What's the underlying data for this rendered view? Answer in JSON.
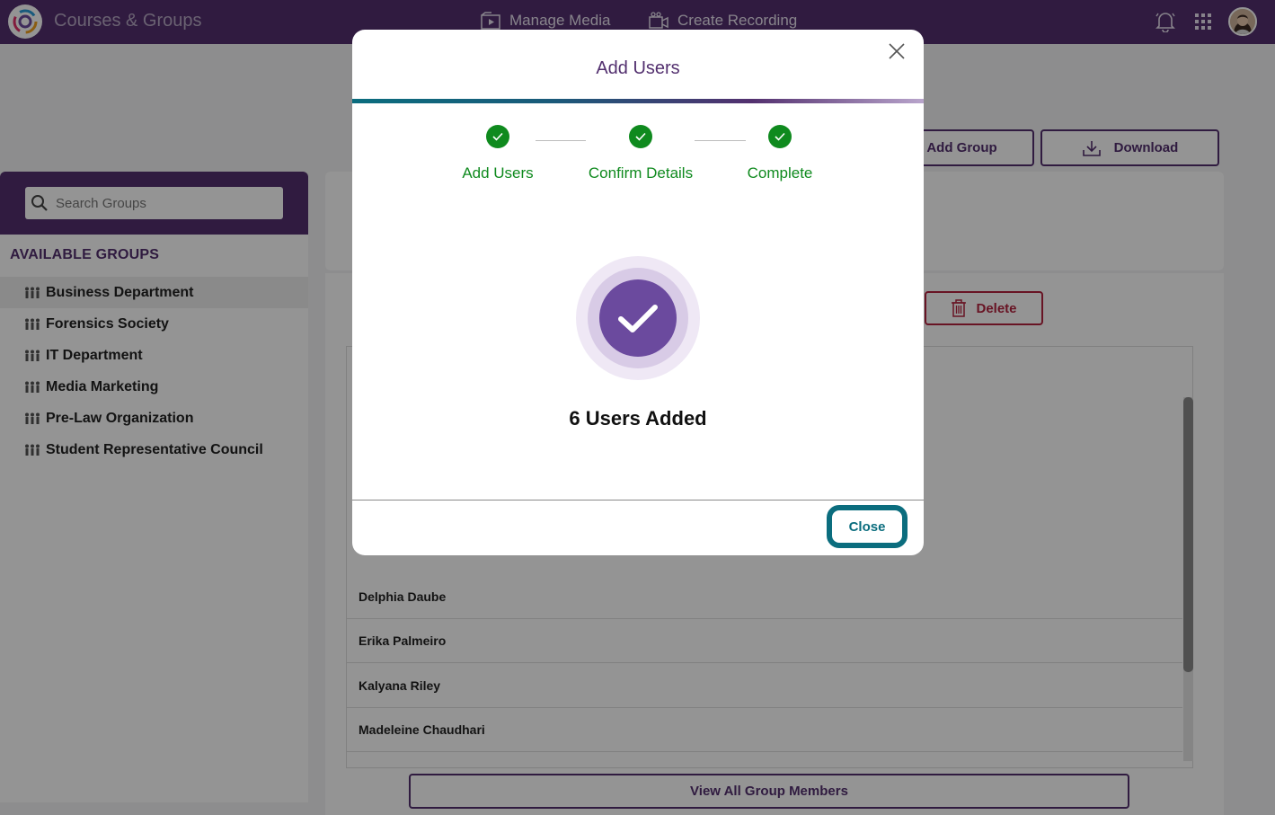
{
  "topbar": {
    "app_title": "Courses & Groups",
    "nav": [
      {
        "label": "Manage Media",
        "icon": "media-icon"
      },
      {
        "label": "Create Recording",
        "icon": "recording-icon"
      }
    ],
    "icons": [
      "bell-icon",
      "apps-grid-icon",
      "avatar"
    ]
  },
  "header_buttons": {
    "add_group": "Add Group",
    "download": "Download"
  },
  "sidebar": {
    "search_placeholder": "Search Groups",
    "section_title": "AVAILABLE GROUPS",
    "groups": [
      "Business Department",
      "Forensics Society",
      "IT Department",
      "Media Marketing",
      "Pre-Law Organization",
      "Student Representative Council"
    ]
  },
  "main": {
    "delete_label": "Delete",
    "members": [
      "Delphia Daube",
      "Erika Palmeiro",
      "Kalyana Riley",
      "Madeleine Chaudhari"
    ],
    "view_all_label": "View All Group Members"
  },
  "modal": {
    "title": "Add Users",
    "steps": [
      {
        "label": "Add Users",
        "status": "complete"
      },
      {
        "label": "Confirm Details",
        "status": "complete"
      },
      {
        "label": "Complete",
        "status": "complete"
      }
    ],
    "message": "6 Users Added",
    "close_label": "Close"
  },
  "colors": {
    "brand": "#53306f",
    "step_complete": "#0f8a1e",
    "focus_ring": "#0b6d7e",
    "danger": "#b3233f"
  }
}
